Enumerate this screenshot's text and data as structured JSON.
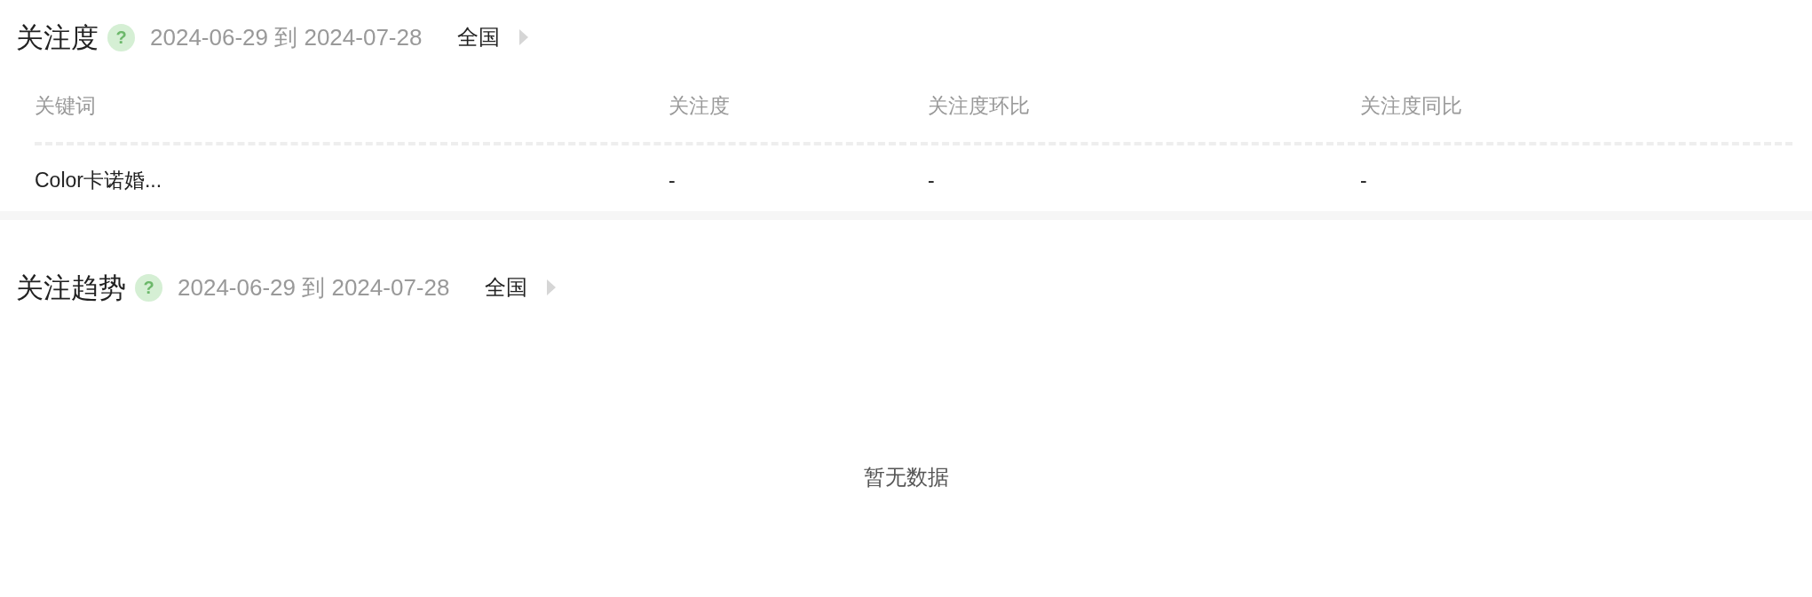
{
  "attention": {
    "title": "关注度",
    "help": "?",
    "date_range": "2024-06-29 到 2024-07-28",
    "region": "全国",
    "table": {
      "columns": [
        "关键词",
        "关注度",
        "关注度环比",
        "关注度同比"
      ],
      "rows": [
        [
          "Color卡诺婚...",
          "-",
          "-",
          "-"
        ]
      ]
    }
  },
  "trend": {
    "title": "关注趋势",
    "help": "?",
    "date_range": "2024-06-29 到 2024-07-28",
    "region": "全国",
    "empty_text": "暂无数据"
  }
}
